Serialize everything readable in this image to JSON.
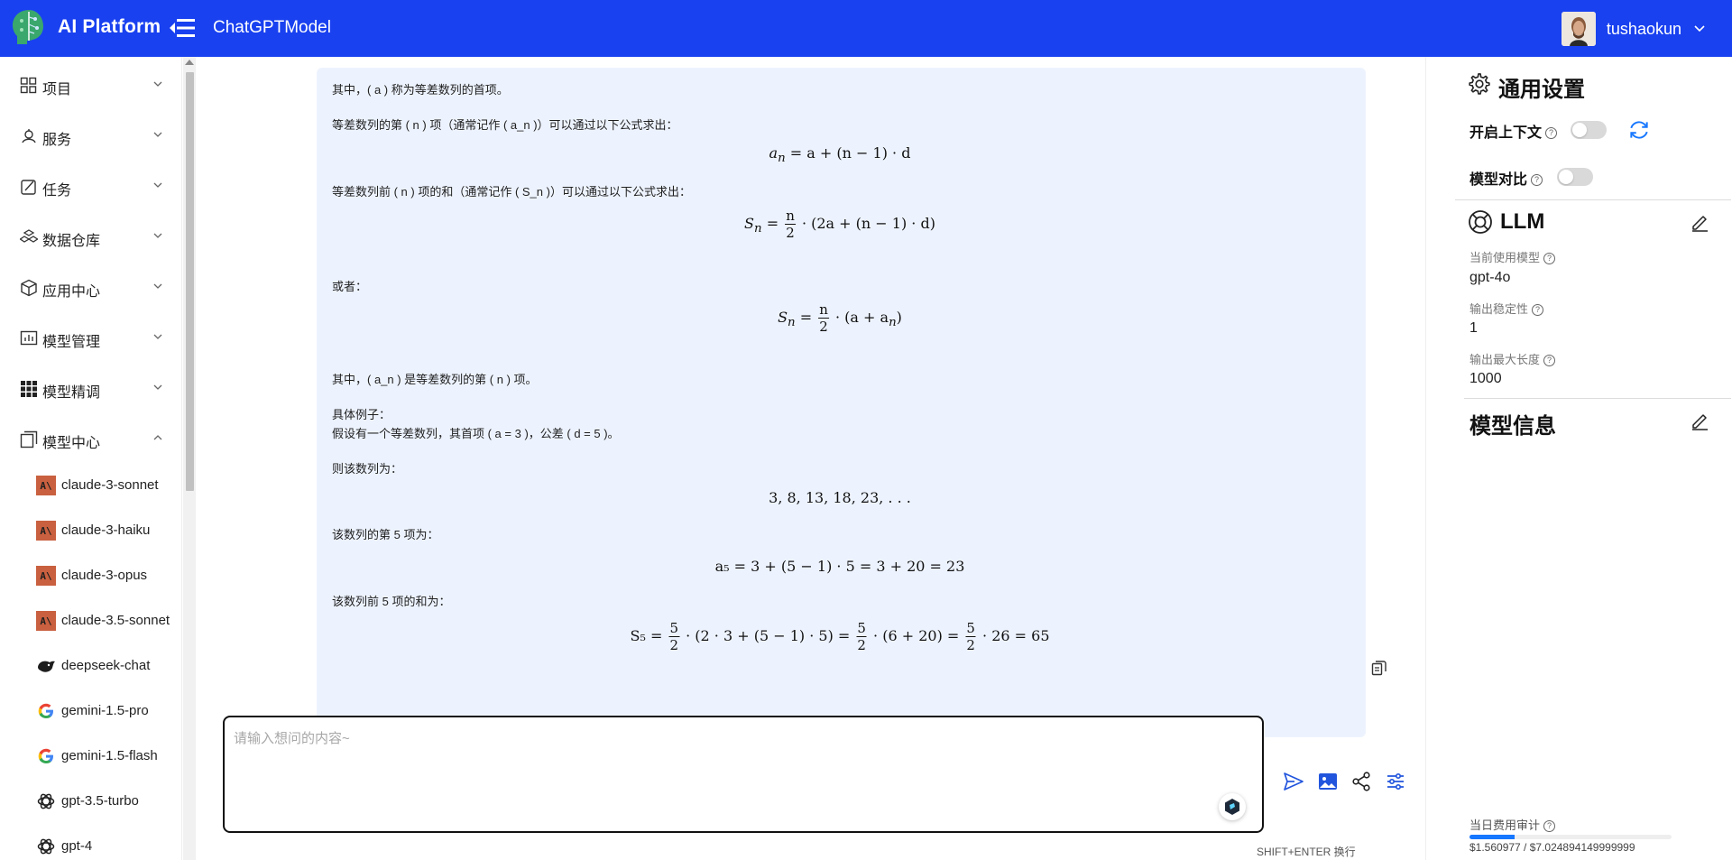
{
  "header": {
    "app_name": "AI Platform",
    "page_title": "ChatGPTModel",
    "username": "tushaokun"
  },
  "sidebar": {
    "items": [
      {
        "label": "项目",
        "icon": "grid-icon"
      },
      {
        "label": "服务",
        "icon": "service-icon"
      },
      {
        "label": "任务",
        "icon": "task-icon"
      },
      {
        "label": "数据仓库",
        "icon": "database-icon"
      },
      {
        "label": "应用中心",
        "icon": "cube-icon"
      },
      {
        "label": "模型管理",
        "icon": "chart-icon"
      },
      {
        "label": "模型精调",
        "icon": "apps-icon"
      },
      {
        "label": "模型中心",
        "icon": "copy-icon"
      }
    ],
    "models": [
      {
        "label": "claude-3-sonnet",
        "icon": "anthropic-icon"
      },
      {
        "label": "claude-3-haiku",
        "icon": "anthropic-icon"
      },
      {
        "label": "claude-3-opus",
        "icon": "anthropic-icon"
      },
      {
        "label": "claude-3.5-sonnet",
        "icon": "anthropic-icon"
      },
      {
        "label": "deepseek-chat",
        "icon": "deepseek-icon"
      },
      {
        "label": "gemini-1.5-pro",
        "icon": "google-icon"
      },
      {
        "label": "gemini-1.5-flash",
        "icon": "google-icon"
      },
      {
        "label": "gpt-3.5-turbo",
        "icon": "openai-icon"
      },
      {
        "label": "gpt-4",
        "icon": "openai-icon"
      }
    ]
  },
  "chat": {
    "lines": {
      "l1": "其中，( a ) 称为等差数列的首项。",
      "l2": "等差数列的第 ( n ) 项（通常记作 ( a_n )）可以通过以下公式求出：",
      "l3": "等差数列前 ( n ) 项的和（通常记作 ( S_n )）可以通过以下公式求出：",
      "l4": "或者：",
      "l5": "其中，( a_n ) 是等差数列的第 ( n ) 项。",
      "l6": "具体例子：",
      "l7": "假设有一个等差数列，其首项 ( a = 3 )，公差 ( d = 5 )。",
      "l8": "则该数列为：",
      "l9": "该数列的第 5 项为：",
      "l10": "该数列前 5 项的和为："
    },
    "formulas": {
      "f1_lhs": "a",
      "f1_sub": "n",
      "f1_rhs": " = a + (n − 1) · d",
      "f2_lhs": "S",
      "f2_sub": "n",
      "f2_num": "n",
      "f2_den": "2",
      "f2_rhs": "· (2a + (n − 1) · d)",
      "f3_lhs": "S",
      "f3_sub": "n",
      "f3_num": "n",
      "f3_den": "2",
      "f3_rhs": "· (a + a",
      "f4": "3, 8, 13, 18, 23, . . .",
      "f5": "a₅ = 3 + (5 − 1) · 5 = 3 + 20 = 23",
      "f6_lhs": "S₅ =",
      "f6_num": "5",
      "f6_den": "2",
      "f6_part1": "· (2 · 3 + (5 − 1) · 5) =",
      "f6_part2": "· (6 + 20) =",
      "f6_part3": "· 26 = 65"
    },
    "input_placeholder": "请输入想问的内容~",
    "hint": "SHIFT+ENTER 换行"
  },
  "right_panel": {
    "general_title": "通用设置",
    "context_label": "开启上下文",
    "compare_label": "模型对比",
    "llm_title": "LLM",
    "current_model_label": "当前使用模型",
    "current_model_value": "gpt-4o",
    "stability_label": "输出稳定性",
    "stability_value": "1",
    "max_length_label": "输出最大长度",
    "max_length_value": "1000",
    "model_info_title": "模型信息",
    "cost_label": "当日费用审计",
    "cost_value": "$1.560977 / $7.024894149999999",
    "cost_fraction": 0.222
  },
  "colors": {
    "header_bg": "#1941f0",
    "bubble_bg": "#edf3fe",
    "accent": "#1677ff"
  }
}
